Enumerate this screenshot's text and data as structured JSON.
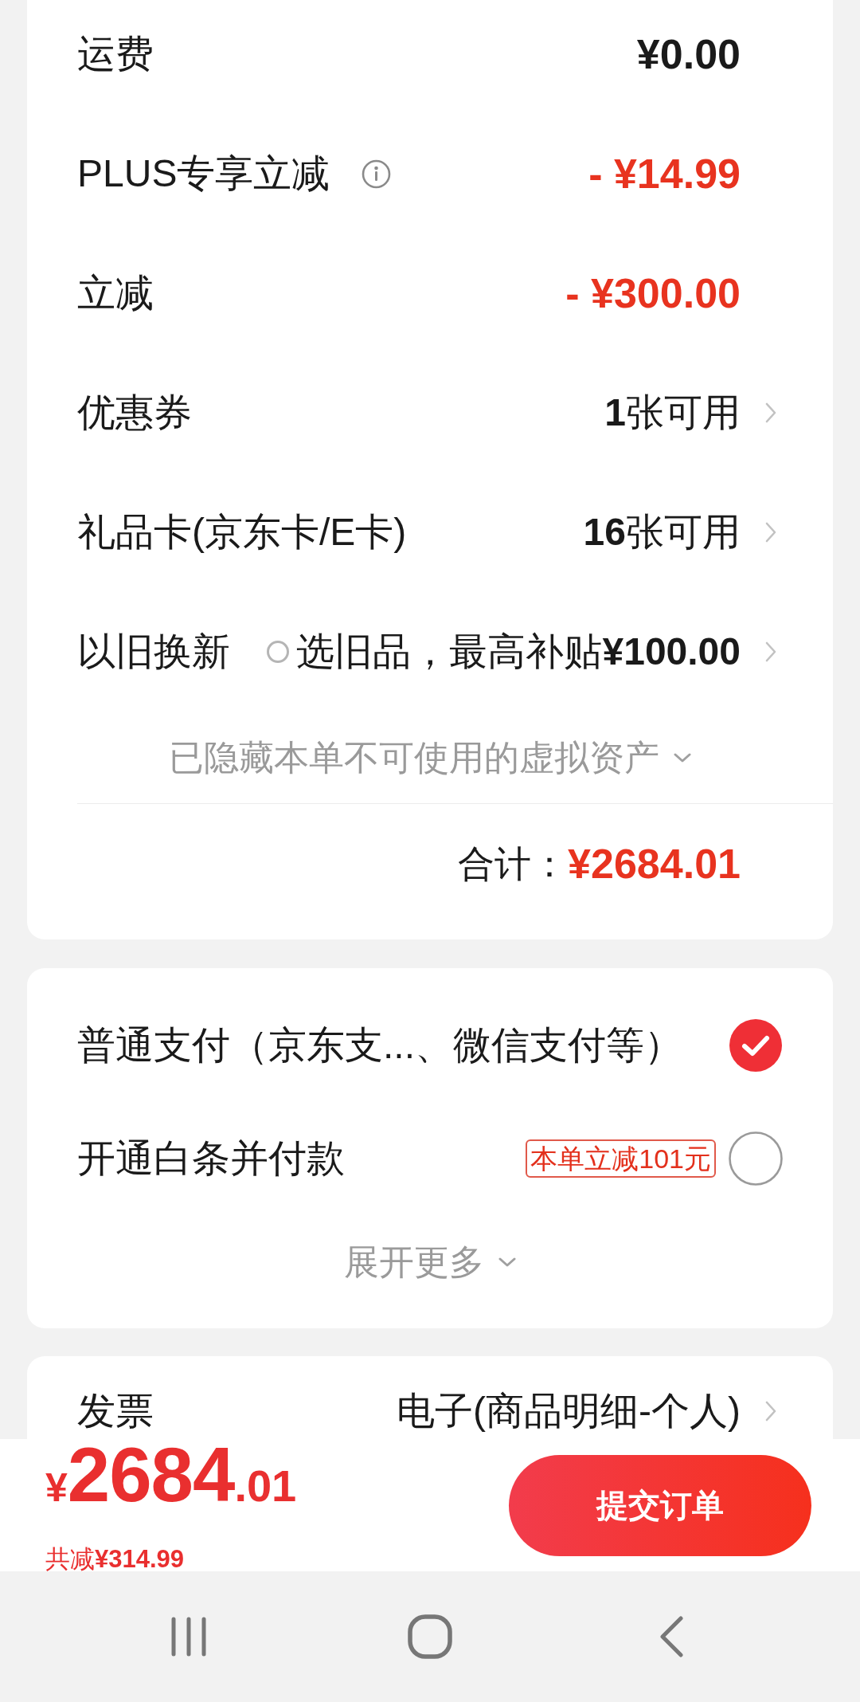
{
  "summary_card": {
    "rows": [
      {
        "kind": "amount",
        "label": "运费",
        "value": "¥0.00",
        "highlight": false
      },
      {
        "kind": "amount",
        "label": "PLUS专享立减",
        "info": true,
        "value": "- ¥14.99",
        "highlight": true
      },
      {
        "kind": "amount",
        "label": "立减",
        "value": "- ¥300.00",
        "highlight": true
      },
      {
        "kind": "link",
        "label": "优惠券",
        "value": "**1**张可用",
        "highlight": false
      },
      {
        "kind": "link",
        "label": "礼品卡(京东卡/E卡)",
        "value": "**16**张可用",
        "highlight": false
      },
      {
        "kind": "link",
        "label": "以旧换新",
        "ring": true,
        "value": "选旧品，最高补贴**¥100.00**",
        "highlight": false
      }
    ],
    "hidden_assets": "已隐藏本单不可使用的虚拟资产",
    "total": {
      "label": "合计：",
      "value": "¥2684.01"
    }
  },
  "payment_card": {
    "options": [
      {
        "label": "普通支付（京东支...、微信支付等）",
        "selected": true
      },
      {
        "label": "开通白条并付款",
        "badge": "本单立减101元",
        "selected": false
      }
    ],
    "expand": "展开更多"
  },
  "invoice_card": {
    "rows": [
      {
        "label": "发票",
        "value": "电子(商品明细-个人)"
      }
    ]
  },
  "bottom_bar": {
    "currency": "¥",
    "price_integer": "2684",
    "price_decimal": ".01",
    "saving": "共减**¥314.99**",
    "submit": "提交订单"
  }
}
